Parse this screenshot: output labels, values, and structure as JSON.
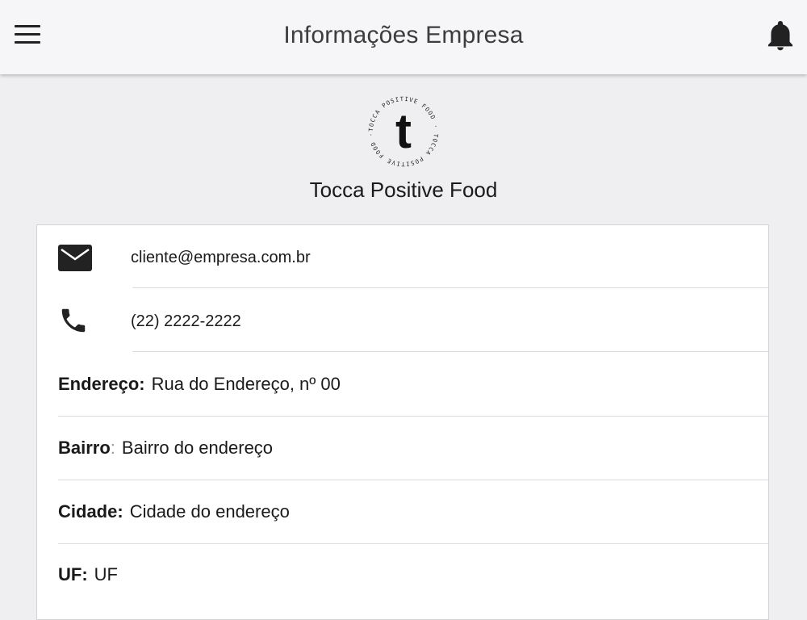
{
  "header": {
    "title": "Informações Empresa",
    "menu_icon": "hamburger-menu-icon",
    "notification_icon": "bell-icon"
  },
  "company": {
    "logo_letter": "t",
    "logo_ring_text": "TOCCA POSITIVE FOOD · TOCCA POSITIVE FOOD ·",
    "name": "Tocca Positive Food"
  },
  "contact": {
    "email": "cliente@empresa.com.br",
    "phone": "(22) 2222-2222"
  },
  "address": {
    "street_label": "Endereço",
    "street_value": "Rua do Endereço, nº 00",
    "district_label": "Bairro",
    "district_value": "Bairro do endereço",
    "city_label": "Cidade",
    "city_value": "Cidade do endereço",
    "state_label": "UF",
    "state_value": "UF"
  },
  "colors": {
    "background": "#efeef1",
    "appbar": "#f6f5f7",
    "card": "#ffffff",
    "icon": "#222222"
  }
}
